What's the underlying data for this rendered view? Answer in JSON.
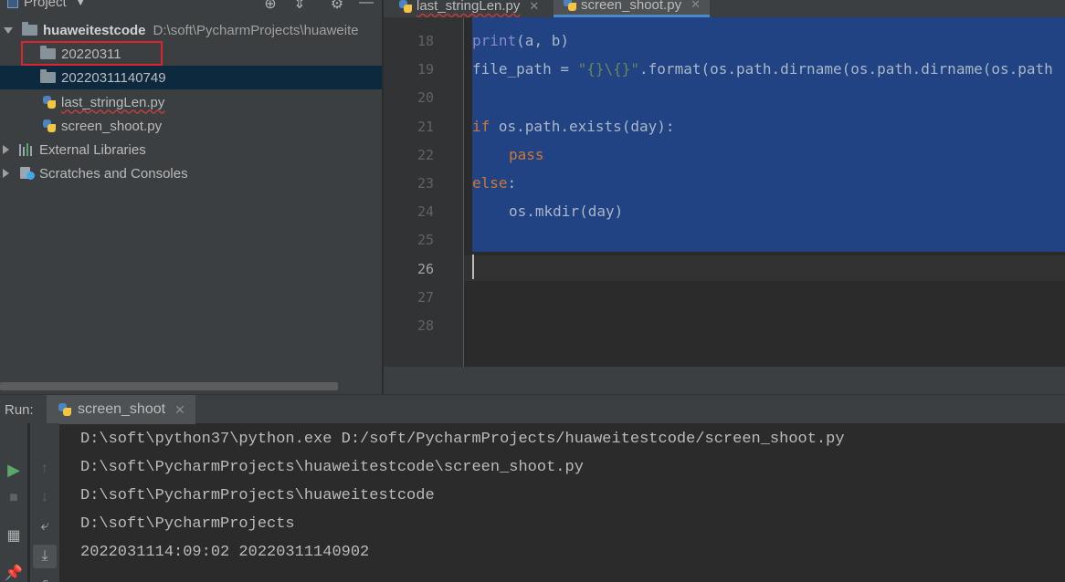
{
  "project": {
    "title": "Project",
    "root_name": "huaweitestcode",
    "root_path": "D:\\soft\\PycharmProjects\\huaweite",
    "items": [
      {
        "label": "20220311"
      },
      {
        "label": "20220311140749"
      },
      {
        "label": "last_stringLen.py"
      },
      {
        "label": "screen_shoot.py"
      }
    ],
    "external_libraries": "External Libraries",
    "scratches": "Scratches and Consoles"
  },
  "editor": {
    "tabs": [
      {
        "label": "last_stringLen.py"
      },
      {
        "label": "screen_shoot.py"
      }
    ],
    "line_numbers": [
      "18",
      "19",
      "20",
      "21",
      "22",
      "23",
      "24",
      "25",
      "26",
      "27",
      "28"
    ],
    "code": {
      "l18_fn": "print",
      "l18_args": "(a, b)",
      "l19_a": "file_path = ",
      "l19_str": "\"{}\\{}\"",
      "l19_b": ".format(os.path.dirname(os.path.dirname(os.path",
      "l21_kw": "if",
      "l21_rest": " os.path.exists(day):",
      "l22_kw": "pass",
      "l23_kw": "else",
      "l23_rest": ":",
      "l24": "os.mkdir(day)"
    }
  },
  "run": {
    "label": "Run:",
    "tab": "screen_shoot",
    "output": [
      "D:\\soft\\python37\\python.exe D:/soft/PycharmProjects/huaweitestcode/screen_shoot.py",
      "D:\\soft\\PycharmProjects\\huaweitestcode\\screen_shoot.py",
      "D:\\soft\\PycharmProjects\\huaweitestcode",
      "D:\\soft\\PycharmProjects",
      "2022031114:09:02 20220311140902"
    ]
  },
  "colors": {
    "selection": "#214283",
    "highlight_box": "#d9262e",
    "run_green": "#59a869"
  }
}
